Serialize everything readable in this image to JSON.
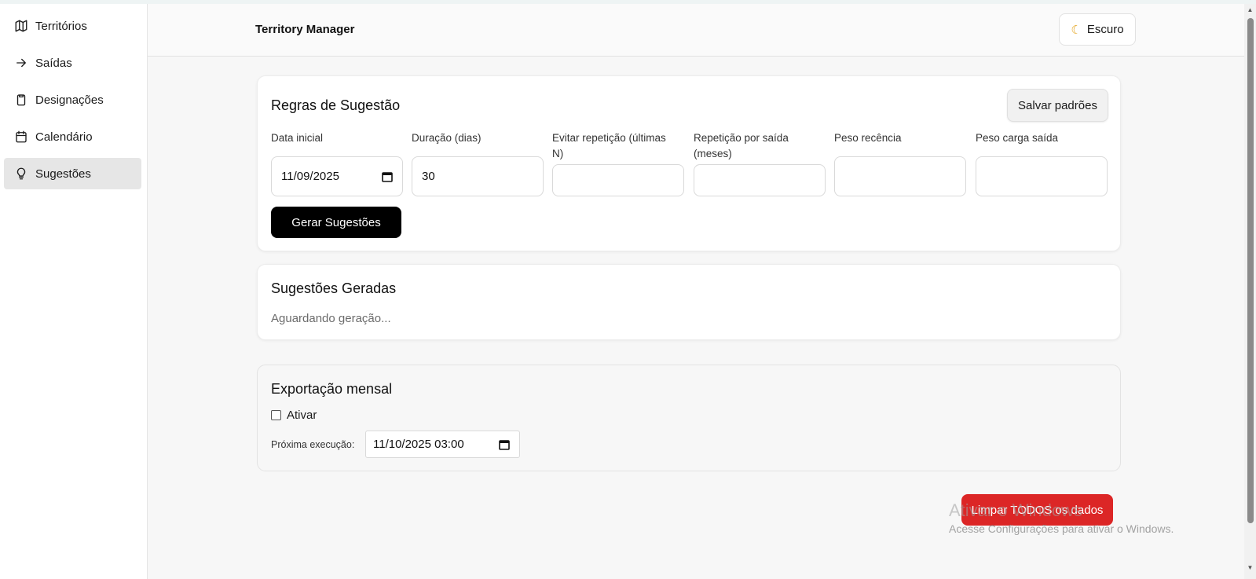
{
  "sidebar": {
    "items": [
      {
        "label": "Territórios",
        "icon": "map-icon"
      },
      {
        "label": "Saídas",
        "icon": "arrow-right-icon"
      },
      {
        "label": "Designações",
        "icon": "clipboard-icon"
      },
      {
        "label": "Calendário",
        "icon": "calendar-icon"
      },
      {
        "label": "Sugestões",
        "icon": "lightbulb-icon",
        "active": true
      }
    ]
  },
  "header": {
    "title": "Territory Manager",
    "theme_toggle": {
      "label": "Escuro",
      "icon": "moon-icon"
    }
  },
  "rules": {
    "title": "Regras de Sugestão",
    "save_defaults_label": "Salvar padrões",
    "fields": {
      "start_date": {
        "label": "Data inicial",
        "value": "11/09/2025"
      },
      "duration": {
        "label": "Duração (dias)",
        "value": "30"
      },
      "avoid_repeat": {
        "label": "Evitar repetição (últimas N)",
        "value": ""
      },
      "repeat_per_exit": {
        "label": "Repetição por saída (meses)",
        "value": ""
      },
      "recency_weight": {
        "label": "Peso recência",
        "value": ""
      },
      "exit_load_weight": {
        "label": "Peso carga saída",
        "value": ""
      }
    },
    "generate_label": "Gerar Sugestões"
  },
  "generated": {
    "title": "Sugestões Geradas",
    "status": "Aguardando geração..."
  },
  "export": {
    "title": "Exportação mensal",
    "enable_label": "Ativar",
    "enabled": false,
    "next_run_label": "Próxima execução:",
    "next_run_value": "11/10/2025 03:00"
  },
  "danger": {
    "clear_all_label": "Limpar TODOS os dados"
  },
  "watermark": {
    "line1": "Ativar o Windows",
    "line2": "Acesse Configurações para ativar o Windows."
  },
  "colors": {
    "primary_button": "#000000",
    "danger_button": "#dc2626",
    "active_nav_bg": "#e6e6e6"
  }
}
